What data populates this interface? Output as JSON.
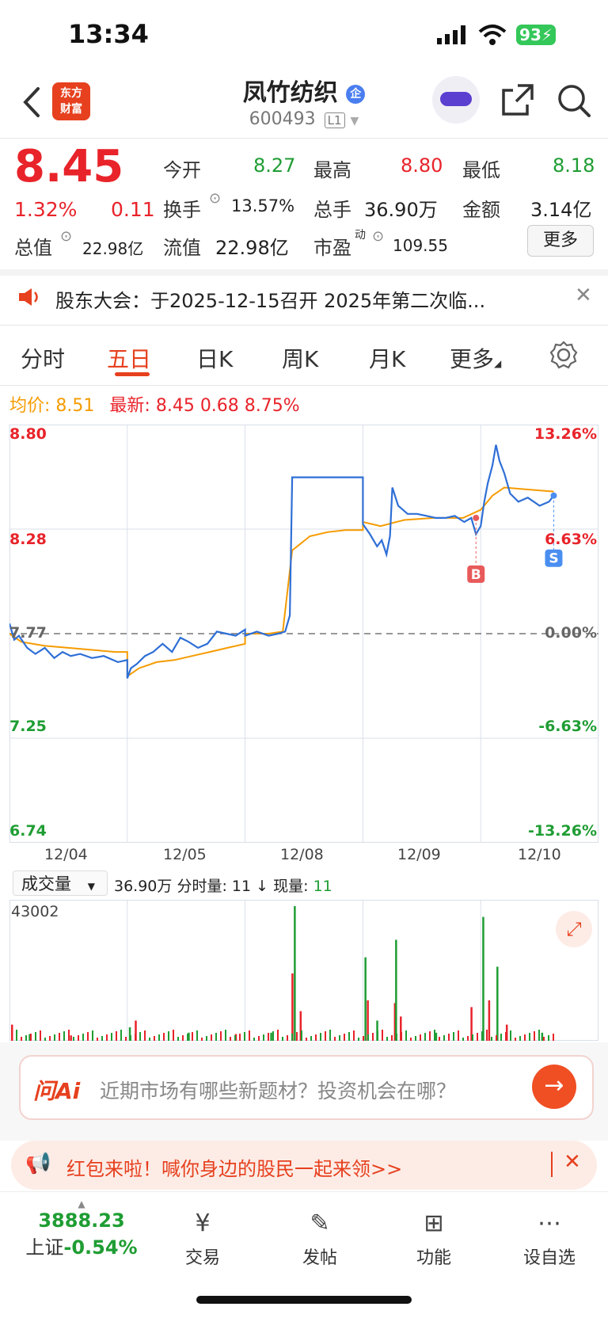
{
  "status_bar": {
    "time": "13:34",
    "battery": "93"
  },
  "nav": {
    "title": "凤竹纺织",
    "title_badge": "企",
    "code": "600493",
    "level": "L1",
    "logo_text_1": "东方",
    "logo_text_2": "财富"
  },
  "quote": {
    "price": "8.45",
    "change_pct": "1.32%",
    "change": "0.11",
    "open_label": "今开",
    "open": "8.27",
    "high_label": "最高",
    "high": "8.80",
    "low_label": "最低",
    "low": "8.18",
    "turnover_label": "换手",
    "turnover": "13.57%",
    "volume_label": "总手",
    "volume": "36.90万",
    "amount_label": "金额",
    "amount": "3.14亿",
    "mktcap_label": "总值",
    "mktcap": "22.98亿",
    "float_label": "流值",
    "float_cap": "22.98亿",
    "pe_label": "市盈",
    "pe_sup": "动",
    "pe": "109.55",
    "more_label": "更多"
  },
  "notice": {
    "text": "股东大会：于2025-12-15召开 2025年第二次临..."
  },
  "tabs": [
    "分时",
    "五日",
    "日K",
    "周K",
    "月K",
    "更多"
  ],
  "chart_header": {
    "avg_label": "均价:",
    "avg": "8.51",
    "latest_label": "最新:",
    "latest": "8.45",
    "chg": "0.68",
    "chg_pct": "8.75%"
  },
  "chart_data": {
    "type": "line",
    "title": "",
    "ylim": [
      6.74,
      8.8
    ],
    "base": 7.77,
    "y_ticks_left": [
      "8.80",
      "8.28",
      "7.77",
      "7.25",
      "6.74"
    ],
    "y_ticks_right": [
      "13.26%",
      "6.63%",
      "0.00%",
      "-6.63%",
      "-13.26%"
    ],
    "x_ticks": [
      "12/04",
      "12/05",
      "12/08",
      "12/09",
      "12/10"
    ],
    "series": [
      {
        "color": "#2f6fd6",
        "values": [
          [
            0,
            7.82
          ],
          [
            0.04,
            7.74
          ],
          [
            0.08,
            7.76
          ],
          [
            0.15,
            7.7
          ],
          [
            0.22,
            7.67
          ],
          [
            0.3,
            7.7
          ],
          [
            0.38,
            7.65
          ],
          [
            0.45,
            7.68
          ],
          [
            0.52,
            7.66
          ],
          [
            0.6,
            7.67
          ],
          [
            0.7,
            7.65
          ],
          [
            0.8,
            7.66
          ],
          [
            0.92,
            7.63
          ],
          [
            1.0,
            7.64
          ],
          [
            1.0,
            7.55
          ],
          [
            1.03,
            7.6
          ],
          [
            1.08,
            7.62
          ],
          [
            1.15,
            7.66
          ],
          [
            1.22,
            7.68
          ],
          [
            1.3,
            7.72
          ],
          [
            1.38,
            7.68
          ],
          [
            1.45,
            7.75
          ],
          [
            1.52,
            7.73
          ],
          [
            1.6,
            7.7
          ],
          [
            1.68,
            7.72
          ],
          [
            1.76,
            7.78
          ],
          [
            1.84,
            7.77
          ],
          [
            1.92,
            7.76
          ],
          [
            2.0,
            7.79
          ],
          [
            2.0,
            7.76
          ],
          [
            2.1,
            7.78
          ],
          [
            2.2,
            7.76
          ],
          [
            2.28,
            7.77
          ],
          [
            2.34,
            7.78
          ],
          [
            2.38,
            7.86
          ],
          [
            2.4,
            8.54
          ],
          [
            2.5,
            8.54
          ],
          [
            2.6,
            8.54
          ],
          [
            2.7,
            8.54
          ],
          [
            2.8,
            8.54
          ],
          [
            2.9,
            8.54
          ],
          [
            3.0,
            8.54
          ],
          [
            3.0,
            8.31
          ],
          [
            3.06,
            8.26
          ],
          [
            3.12,
            8.2
          ],
          [
            3.16,
            8.23
          ],
          [
            3.2,
            8.16
          ],
          [
            3.23,
            8.25
          ],
          [
            3.25,
            8.49
          ],
          [
            3.3,
            8.4
          ],
          [
            3.38,
            8.36
          ],
          [
            3.46,
            8.36
          ],
          [
            3.54,
            8.35
          ],
          [
            3.62,
            8.34
          ],
          [
            3.7,
            8.34
          ],
          [
            3.78,
            8.35
          ],
          [
            3.86,
            8.32
          ],
          [
            3.92,
            8.34
          ],
          [
            3.96,
            8.26
          ],
          [
            4.0,
            8.3
          ],
          [
            4.03,
            8.42
          ],
          [
            4.06,
            8.51
          ],
          [
            4.1,
            8.6
          ],
          [
            4.13,
            8.7
          ],
          [
            4.16,
            8.62
          ],
          [
            4.2,
            8.56
          ],
          [
            4.25,
            8.46
          ],
          [
            4.32,
            8.42
          ],
          [
            4.4,
            8.44
          ],
          [
            4.5,
            8.4
          ],
          [
            4.58,
            8.42
          ],
          [
            4.62,
            8.45
          ]
        ]
      },
      {
        "color": "#f59b00",
        "values": [
          [
            0,
            7.77
          ],
          [
            0.1,
            7.73
          ],
          [
            0.3,
            7.71
          ],
          [
            0.5,
            7.7
          ],
          [
            0.7,
            7.69
          ],
          [
            0.9,
            7.68
          ],
          [
            1.0,
            7.68
          ],
          [
            1.0,
            7.56
          ],
          [
            1.1,
            7.6
          ],
          [
            1.25,
            7.63
          ],
          [
            1.4,
            7.64
          ],
          [
            1.55,
            7.66
          ],
          [
            1.7,
            7.68
          ],
          [
            1.85,
            7.7
          ],
          [
            2.0,
            7.72
          ],
          [
            2.0,
            7.77
          ],
          [
            2.2,
            7.77
          ],
          [
            2.32,
            7.78
          ],
          [
            2.4,
            8.18
          ],
          [
            2.55,
            8.25
          ],
          [
            2.7,
            8.27
          ],
          [
            2.85,
            8.28
          ],
          [
            3.0,
            8.28
          ],
          [
            3.0,
            8.32
          ],
          [
            3.15,
            8.3
          ],
          [
            3.35,
            8.33
          ],
          [
            3.6,
            8.34
          ],
          [
            3.85,
            8.34
          ],
          [
            4.0,
            8.38
          ],
          [
            4.1,
            8.45
          ],
          [
            4.2,
            8.49
          ],
          [
            4.4,
            8.48
          ],
          [
            4.62,
            8.47
          ]
        ]
      }
    ],
    "markers": [
      {
        "label": "B",
        "x": 3.96,
        "y": 8.34
      },
      {
        "label": "S",
        "x": 4.62,
        "y": 8.45
      }
    ]
  },
  "volume": {
    "indicator": "成交量",
    "total": "36.90万",
    "per_label": "分时量:",
    "per_value": "11",
    "arrow": "↓",
    "now_label": "现量:",
    "now_value": "11",
    "max": "43002",
    "spikes": [
      [
        0.0,
        0.12
      ],
      [
        0.15,
        0.05
      ],
      [
        0.5,
        0.04
      ],
      [
        1.0,
        0.1
      ],
      [
        1.05,
        0.15
      ],
      [
        1.5,
        0.06
      ],
      [
        1.9,
        0.05
      ],
      [
        2.2,
        0.06
      ],
      [
        2.38,
        0.5
      ],
      [
        2.4,
        1.0
      ],
      [
        2.45,
        0.22
      ],
      [
        3.0,
        0.62
      ],
      [
        3.02,
        0.3
      ],
      [
        3.1,
        0.15
      ],
      [
        3.25,
        0.28
      ],
      [
        3.26,
        0.75
      ],
      [
        3.3,
        0.18
      ],
      [
        3.6,
        0.06
      ],
      [
        3.9,
        0.25
      ],
      [
        4.0,
        0.92
      ],
      [
        4.05,
        0.3
      ],
      [
        4.12,
        0.55
      ],
      [
        4.2,
        0.12
      ],
      [
        4.5,
        0.06
      ]
    ]
  },
  "ai": {
    "logo": "问Ai",
    "placeholder": "近期市场有哪些新题材？投资机会在哪？"
  },
  "promo": {
    "text": "红包来啦！喊你身边的股民一起来领>>"
  },
  "bottom_nav": {
    "index_value": "3888.23",
    "index_name": "上证",
    "index_chg": "-0.54%",
    "trade": "交易",
    "post": "发帖",
    "func": "功能",
    "watch": "设自选"
  }
}
